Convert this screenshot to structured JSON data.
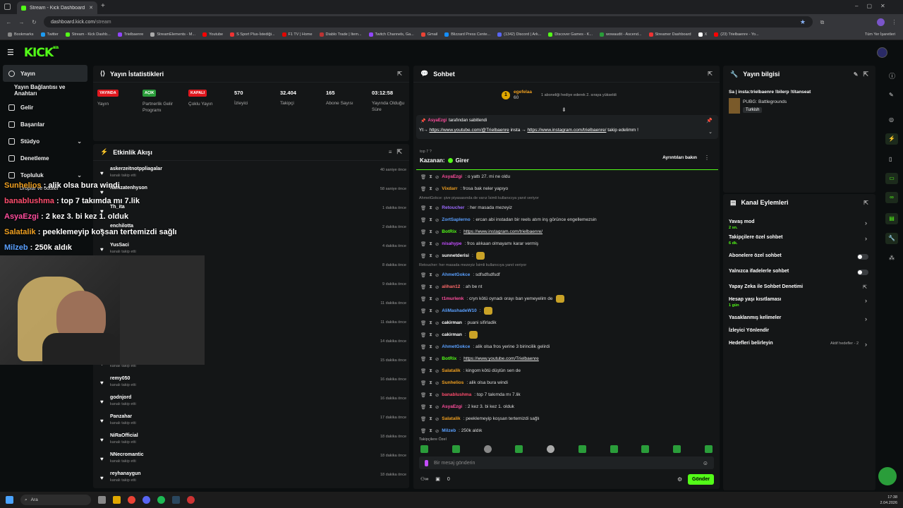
{
  "browser": {
    "tab_title": "Stream - Kick Dashboard",
    "close_tab": "✕",
    "new_tab": "+",
    "url_host": "dashboard.kick.com",
    "url_path": "/stream",
    "bookmarks": [
      {
        "label": "Bookmarks",
        "color": "#888"
      },
      {
        "label": "Twitter",
        "color": "#1d9bf0"
      },
      {
        "label": "Stream - Kick Dashb...",
        "color": "#53fc18"
      },
      {
        "label": "Trielbaenre",
        "color": "#9146ff"
      },
      {
        "label": "StreamElements - M...",
        "color": "#aaa"
      },
      {
        "label": "Youtube",
        "color": "#ff0000"
      },
      {
        "label": "S Sport Plus-İstediği...",
        "color": "#e33"
      },
      {
        "label": "F1 TV | Home",
        "color": "#e10600"
      },
      {
        "label": "Diablo Trade | Item...",
        "color": "#b33"
      },
      {
        "label": "Twitch Channels, Ga...",
        "color": "#9146ff"
      },
      {
        "label": "Gmail",
        "color": "#ea4335"
      },
      {
        "label": "Blizzard Press Cente...",
        "color": "#148eff"
      },
      {
        "label": "(1342) Discord | Ark...",
        "color": "#5865f2"
      },
      {
        "label": "Discover Games - K...",
        "color": "#53fc18"
      },
      {
        "label": "wowaudit - Ascend...",
        "color": "#2a9d3a"
      },
      {
        "label": "Streamer Dashboard",
        "color": "#e33"
      },
      {
        "label": "X",
        "color": "#fff"
      },
      {
        "label": "(23) Trielbaenre - Yo...",
        "color": "#ff0000"
      }
    ],
    "all_bookmarks": "Tüm Yer İşaretleri"
  },
  "sidebar": {
    "items": [
      {
        "label": "Yayın",
        "active": true
      },
      {
        "label": "Yayın Bağlantısı ve Anahtarı"
      },
      {
        "label": "Gelir"
      },
      {
        "label": "Başarılar"
      },
      {
        "label": "Stüdyo"
      },
      {
        "label": "Denetleme"
      },
      {
        "label": "Topluluk"
      },
      {
        "label": "Droplar ve ödüller"
      }
    ]
  },
  "stats": {
    "title": "Yayın İstatistikleri",
    "cells": [
      {
        "badge": "YAYINDA",
        "badge_color": "#e0181f",
        "label": "Yayın"
      },
      {
        "badge": "AÇIK",
        "badge_color": "#2a9d3a",
        "label": "Partnerlik Gelir Programı"
      },
      {
        "badge": "KAPALI",
        "badge_color": "#e0181f",
        "label": "Çoklu Yayın"
      },
      {
        "value": "570",
        "label": "İzleyici"
      },
      {
        "value": "32.404",
        "label": "Takipçi"
      },
      {
        "value": "165",
        "label": "Abone Sayısı"
      },
      {
        "value": "03:12:58",
        "label": "Yayında Olduğu Süre"
      }
    ]
  },
  "activity": {
    "title": "Etkinlik Akışı",
    "items": [
      {
        "name": "askerzeitnotppliagalar",
        "sub": "kanalı takip etti",
        "time": "40 saniye önce"
      },
      {
        "name": "hamzatenhyson",
        "sub": "",
        "time": "58 saniye önce"
      },
      {
        "name": "Th_ita",
        "sub": "",
        "time": "1 dakika önce"
      },
      {
        "name": "enchilotta",
        "sub": "",
        "time": "2 dakika önce"
      },
      {
        "name": "YusSaci",
        "sub": "kanalı takip etti",
        "time": "4 dakika önce"
      },
      {
        "name": "",
        "sub": "",
        "time": "8 dakika önce"
      },
      {
        "name": "",
        "sub": "",
        "time": "9 dakika önce"
      },
      {
        "name": "",
        "sub": "",
        "time": "11 dakika önce"
      },
      {
        "name": "",
        "sub": "",
        "time": "11 dakika önce"
      },
      {
        "name": "",
        "sub": "",
        "time": "14 dakika önce"
      },
      {
        "name": "",
        "sub": "kanalı takip etti",
        "time": "15 dakika önce"
      },
      {
        "name": "remy050",
        "sub": "kanalı takip etti",
        "time": "16 dakika önce"
      },
      {
        "name": "godnjord",
        "sub": "kanalı takip etti",
        "time": "16 dakika önce"
      },
      {
        "name": "Panzahar",
        "sub": "kanalı takip etti",
        "time": "17 dakika önce"
      },
      {
        "name": "NiRaOfficial",
        "sub": "kanalı takip etti",
        "time": "18 dakika önce"
      },
      {
        "name": "NNecromantic",
        "sub": "kanalı takip etti",
        "time": "18 dakika önce"
      },
      {
        "name": "reyhanaygun",
        "sub": "kanalı takip etti",
        "time": "18 dakika önce"
      }
    ]
  },
  "overlay": [
    {
      "user": "Sunhelios",
      "user_color": "#f0a020",
      "text": " : alik olsa bura windi"
    },
    {
      "user": "banablushma",
      "user_color": "#ff4d6d",
      "text": " : top 7 takımda mı 7.lik"
    },
    {
      "user": "AsyaEzgi",
      "user_color": "#ff4d9d",
      "text": " : 2 kez 3. bi kez 1. olduk"
    },
    {
      "user": "Salatalik",
      "user_color": "#f0a020",
      "text": " : peeklemeyip koşsan tertemizdi sağlı"
    },
    {
      "user": "Milzeb",
      "user_color": "#5aa0ff",
      "text": " : 250k aldık"
    }
  ],
  "chat": {
    "title": "Sohbet",
    "gift_user": "egefelaa",
    "gift_count": "60",
    "gift_text": "1 aboneliği hediye ederek 2. sıraya yükseldi",
    "pinned_by": "AsyaEzgi",
    "pinned_label": "tarafından sabitlendi",
    "pinned_prefix": "Yt→",
    "pinned_link1": "https://www.youtube.com/@Trielbaenre",
    "pinned_mid": "insta →",
    "pinned_link2": "https://www.instagram.com/trielbaenre/",
    "pinned_suffix": "takip edelimm !",
    "prediction_sub": "top 7 ?",
    "prediction_winner_label": "Kazanan:",
    "prediction_winner": "Girer",
    "prediction_details": "Ayrıntıları bakın",
    "messages": [
      {
        "user": "AsyaEzgi",
        "color": "#ff4d9d",
        "text": ": o yattı 27. mi ne oldu"
      },
      {
        "user": "Vixdarr",
        "color": "#f0a020",
        "text": ": frosa bak neler yapıyo"
      },
      {
        "system": "AhmetGokce: şive piyasasında de varız İsimli kullanıcıya yanıt veriyor"
      },
      {
        "user": "Retoucher",
        "color": "#9d6bff",
        "text": ": her masada mezeyiz"
      },
      {
        "user": "ZortSaplerno",
        "color": "#5aa0ff",
        "text": ": ercan abi instadan bir reels atım inş görünce engellemezsin"
      },
      {
        "user": "BotRix",
        "color": "#53fc18",
        "text": ": ",
        "link": "https://www.instagram.com/trielbaenre/"
      },
      {
        "user": "nisahype",
        "color": "#c34dff",
        "text": ": fros alıkaan olmayamı karar vermiş"
      },
      {
        "user": "sunnetderisi",
        "color": "#fff",
        "text": ":",
        "emote": true
      },
      {
        "system": "Retoucher: her masada mezeyiz İsimli kullanıcıya yanıt veriyor"
      },
      {
        "user": "AhmetGokce",
        "color": "#5aa0ff",
        "text": ": sdfsdfsdfsdf"
      },
      {
        "user": "alihan12",
        "color": "#ff6a6a",
        "text": ": ah be nt"
      },
      {
        "user": "t1murlenk",
        "color": "#ff4d9d",
        "text": ": cryn kötü oynadı orayı ban yemeyelim de",
        "emote": true
      },
      {
        "user": "AliMashadeW10",
        "color": "#5aa0ff",
        "text": ":",
        "emote": true
      },
      {
        "user": "cakirman",
        "color": "#fff",
        "text": ": puani sifirladik"
      },
      {
        "user": "cakirman",
        "color": "#fff",
        "text": ":",
        "emote": true
      },
      {
        "user": "AhmetGokce",
        "color": "#5aa0ff",
        "text": ": alik olsa fros yerine 3 birincilik gelirdi"
      },
      {
        "user": "BotRix",
        "color": "#53fc18",
        "text": ": ",
        "link": "https://www.youtube.com/Trielbaenre"
      },
      {
        "user": "Salatalik",
        "color": "#f0a020",
        "text": ": kingom kötü düştün sen de"
      },
      {
        "user": "Sunhelios",
        "color": "#f0a020",
        "text": ": alik olsa bura windi"
      },
      {
        "user": "banablushma",
        "color": "#ff4d6d",
        "text": ": top 7 takımda mı 7.lik"
      },
      {
        "user": "AsyaEzgi",
        "color": "#ff4d9d",
        "text": ": 2 kez 3. bi kez 1. olduk"
      },
      {
        "user": "Salatalik",
        "color": "#f0a020",
        "text": ": peeklemeyip koşsan tertemizdi sağlı"
      },
      {
        "user": "Milzeb",
        "color": "#5aa0ff",
        "text": ": 250k aldık"
      }
    ],
    "followers_only": "Takipçilere Özel",
    "input_placeholder": "Bir mesaj gönderin",
    "counter": "0",
    "send": "Gönder"
  },
  "stream_info": {
    "title": "Yayın bilgisi",
    "stream_title": "Sa | insta:trielbaenre !bilerp !titanseat",
    "game": "PUBG: Battlegrounds",
    "language": "Turkish"
  },
  "channel_actions": {
    "title": "Kanal Eylemleri",
    "items": [
      {
        "label": "Yavaş mod",
        "sub": "2 sn.",
        "kind": "chevron"
      },
      {
        "label": "Takipçilere özel sohbet",
        "sub": "6 dk.",
        "kind": "chevron"
      },
      {
        "label": "Abonelere özel sohbet",
        "kind": "toggle"
      },
      {
        "label": "Yalnızca ifadelerle sohbet",
        "kind": "toggle"
      },
      {
        "label": "Yapay Zeka ile Sohbet Denetimi",
        "kind": "ext"
      },
      {
        "label": "Hesap yaşı kısıtlaması",
        "sub": "1 gün",
        "kind": "chevron"
      },
      {
        "label": "Yasaklanmış kelimeler",
        "kind": "chevron"
      },
      {
        "label": "İzleyici Yönlendir",
        "kind": "none"
      },
      {
        "label": "Hedefleri belirleyin",
        "extra": "Aktif hedefler - 2",
        "kind": "chevron"
      }
    ]
  },
  "taskbar": {
    "search": "Ara",
    "time": "17:38",
    "date": "2.04.2026"
  }
}
